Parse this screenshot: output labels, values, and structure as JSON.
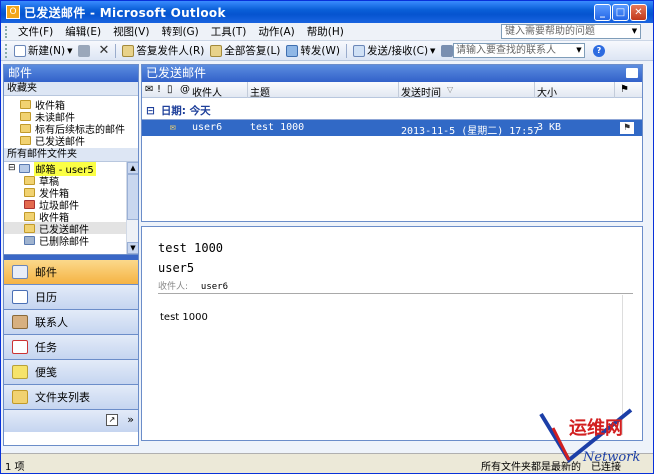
{
  "window": {
    "title": "已发送邮件 - Microsoft Outlook"
  },
  "menu": {
    "items": [
      "文件(F)",
      "编辑(E)",
      "视图(V)",
      "转到(G)",
      "工具(T)",
      "动作(A)",
      "帮助(H)"
    ],
    "help_placeholder": "键入需要帮助的问题"
  },
  "toolbar": {
    "new_label": "新建(N)",
    "reply_label": "答复发件人(R)",
    "reply_all_label": "全部答复(L)",
    "forward_label": "转发(W)",
    "send_receive_label": "发送/接收(C)",
    "search_placeholder": "请输入要查找的联系人"
  },
  "nav": {
    "title": "邮件",
    "favorites_header": "收藏夹",
    "favorites": [
      "收件箱",
      "未读邮件",
      "标有后续标志的邮件",
      "已发送邮件"
    ],
    "all_folders_header": "所有邮件文件夹",
    "mailbox": "邮箱 - user5",
    "folders": [
      "草稿",
      "发件箱",
      "垃圾邮件",
      "收件箱",
      "已发送邮件",
      "已删除邮件"
    ],
    "buttons": [
      "邮件",
      "日历",
      "联系人",
      "任务",
      "便笺",
      "文件夹列表"
    ]
  },
  "list": {
    "title": "已发送邮件",
    "columns": {
      "to": "收件人",
      "subject": "主题",
      "sent": "发送时间",
      "size": "大小"
    },
    "group_label": "日期: 今天",
    "rows": [
      {
        "to": "user6",
        "subject": "test 1000",
        "sent": "2013-11-5 (星期二) 17:57",
        "size": "3 KB"
      }
    ]
  },
  "reading": {
    "subject": "test 1000",
    "from": "user5",
    "to_label": "收件人:",
    "to_value": "user6",
    "body": "test 1000"
  },
  "status": {
    "count": "1 项",
    "sync": "所有文件夹都是最新的",
    "online": "已连接"
  },
  "watermark": {
    "text": "运维网",
    "brand": "Network"
  }
}
